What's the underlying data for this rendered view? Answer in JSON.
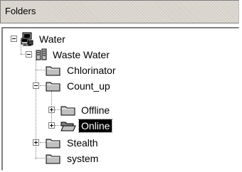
{
  "header": {
    "title": "Folders"
  },
  "tree": {
    "root": {
      "label": "Water",
      "expanded": true
    },
    "waste_water": {
      "label": "Waste Water",
      "expanded": true
    },
    "chlorinator": {
      "label": "Chlorinator"
    },
    "count_up": {
      "label": "Count_up",
      "expanded": true
    },
    "offline": {
      "label": "Offline",
      "expanded": false
    },
    "online": {
      "label": "Online",
      "expanded": false,
      "selected": true
    },
    "stealth": {
      "label": "Stealth",
      "expanded": false
    },
    "system": {
      "label": "system"
    }
  },
  "colors": {
    "selection_bg": "#000000",
    "selection_fg": "#ffffff",
    "folder_fill": "#c0c0c0",
    "tree_line": "#808080"
  }
}
